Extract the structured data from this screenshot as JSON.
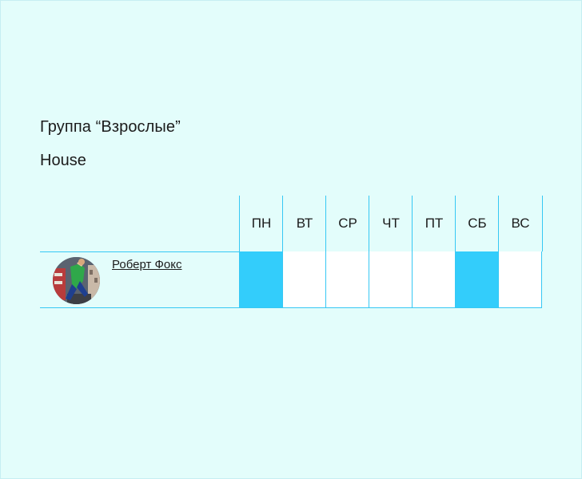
{
  "group_title": "Группа “Взрослые”",
  "dance_style": "House",
  "days": [
    "ПН",
    "ВТ",
    "СР",
    "ЧТ",
    "ПТ",
    "СБ",
    "ВС"
  ],
  "rows": [
    {
      "student_name": "Роберт Фокс",
      "attendance": [
        true,
        false,
        false,
        false,
        false,
        true,
        false
      ]
    }
  ],
  "colors": {
    "background": "#e3fdfb",
    "grid_line": "#36c8f4",
    "active_cell": "#33cdfb",
    "empty_cell": "#ffffff"
  }
}
